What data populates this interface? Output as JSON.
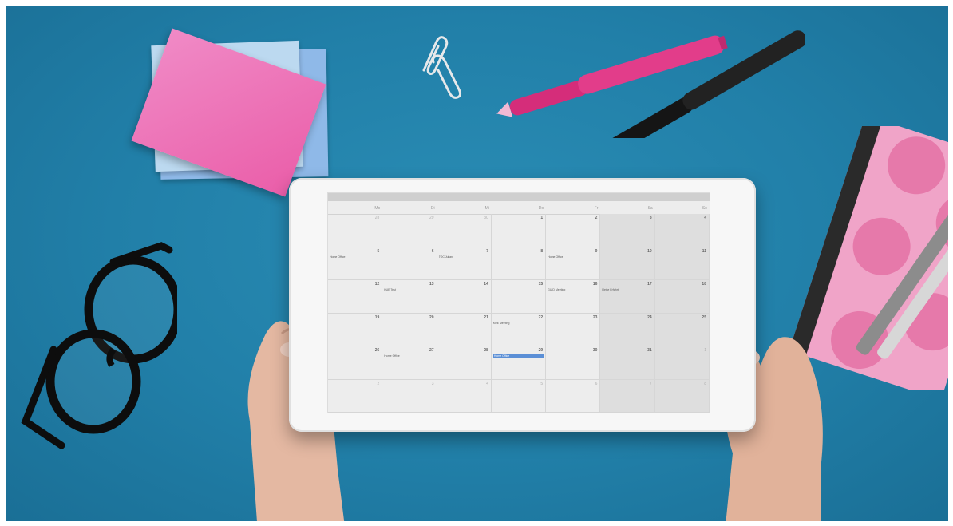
{
  "calendar": {
    "weekdays": [
      "Mo",
      "Di",
      "Mi",
      "Do",
      "Fr",
      "Sa",
      "So"
    ],
    "weeks": [
      [
        {
          "d": "28",
          "dim": true
        },
        {
          "d": "29",
          "dim": true
        },
        {
          "d": "30",
          "dim": true
        },
        {
          "d": "1"
        },
        {
          "d": "2"
        },
        {
          "d": "3"
        },
        {
          "d": "4"
        }
      ],
      [
        {
          "d": "5",
          "ev": "Home Office"
        },
        {
          "d": "6"
        },
        {
          "d": "7",
          "ev": "TOC Julian"
        },
        {
          "d": "8"
        },
        {
          "d": "9",
          "ev": "Home Office"
        },
        {
          "d": "10"
        },
        {
          "d": "11"
        }
      ],
      [
        {
          "d": "12"
        },
        {
          "d": "13",
          "ev": "KUE Test"
        },
        {
          "d": "14"
        },
        {
          "d": "15"
        },
        {
          "d": "16",
          "ev": "GUID Meeting"
        },
        {
          "d": "17",
          "ev": "Reise Erfahrt"
        },
        {
          "d": "18"
        }
      ],
      [
        {
          "d": "19"
        },
        {
          "d": "20"
        },
        {
          "d": "21"
        },
        {
          "d": "22",
          "ev": "KUE Meeting"
        },
        {
          "d": "23"
        },
        {
          "d": "24"
        },
        {
          "d": "25"
        }
      ],
      [
        {
          "d": "26"
        },
        {
          "d": "27",
          "ev": "Home Office"
        },
        {
          "d": "28"
        },
        {
          "d": "29",
          "ev": "Home Office",
          "sel": true
        },
        {
          "d": "30"
        },
        {
          "d": "31"
        },
        {
          "d": "1",
          "dim": true
        }
      ],
      [
        {
          "d": "2",
          "dim": true
        },
        {
          "d": "3",
          "dim": true
        },
        {
          "d": "4",
          "dim": true
        },
        {
          "d": "5",
          "dim": true
        },
        {
          "d": "6",
          "dim": true
        },
        {
          "d": "7",
          "dim": true
        },
        {
          "d": "8",
          "dim": true
        }
      ]
    ]
  },
  "colors": {
    "background": "#217fa8",
    "sticky_pink": "#ea5ea9",
    "sticky_blue": "#8fb9e8",
    "pen_pink": "#e23d8a",
    "pen_black": "#151515",
    "notebook_pink": "#f0a4c8",
    "selected_event": "#5b8fd6"
  },
  "icons": [
    "paperclip-icon",
    "glasses-icon",
    "pen-icon",
    "notebook-icon"
  ]
}
